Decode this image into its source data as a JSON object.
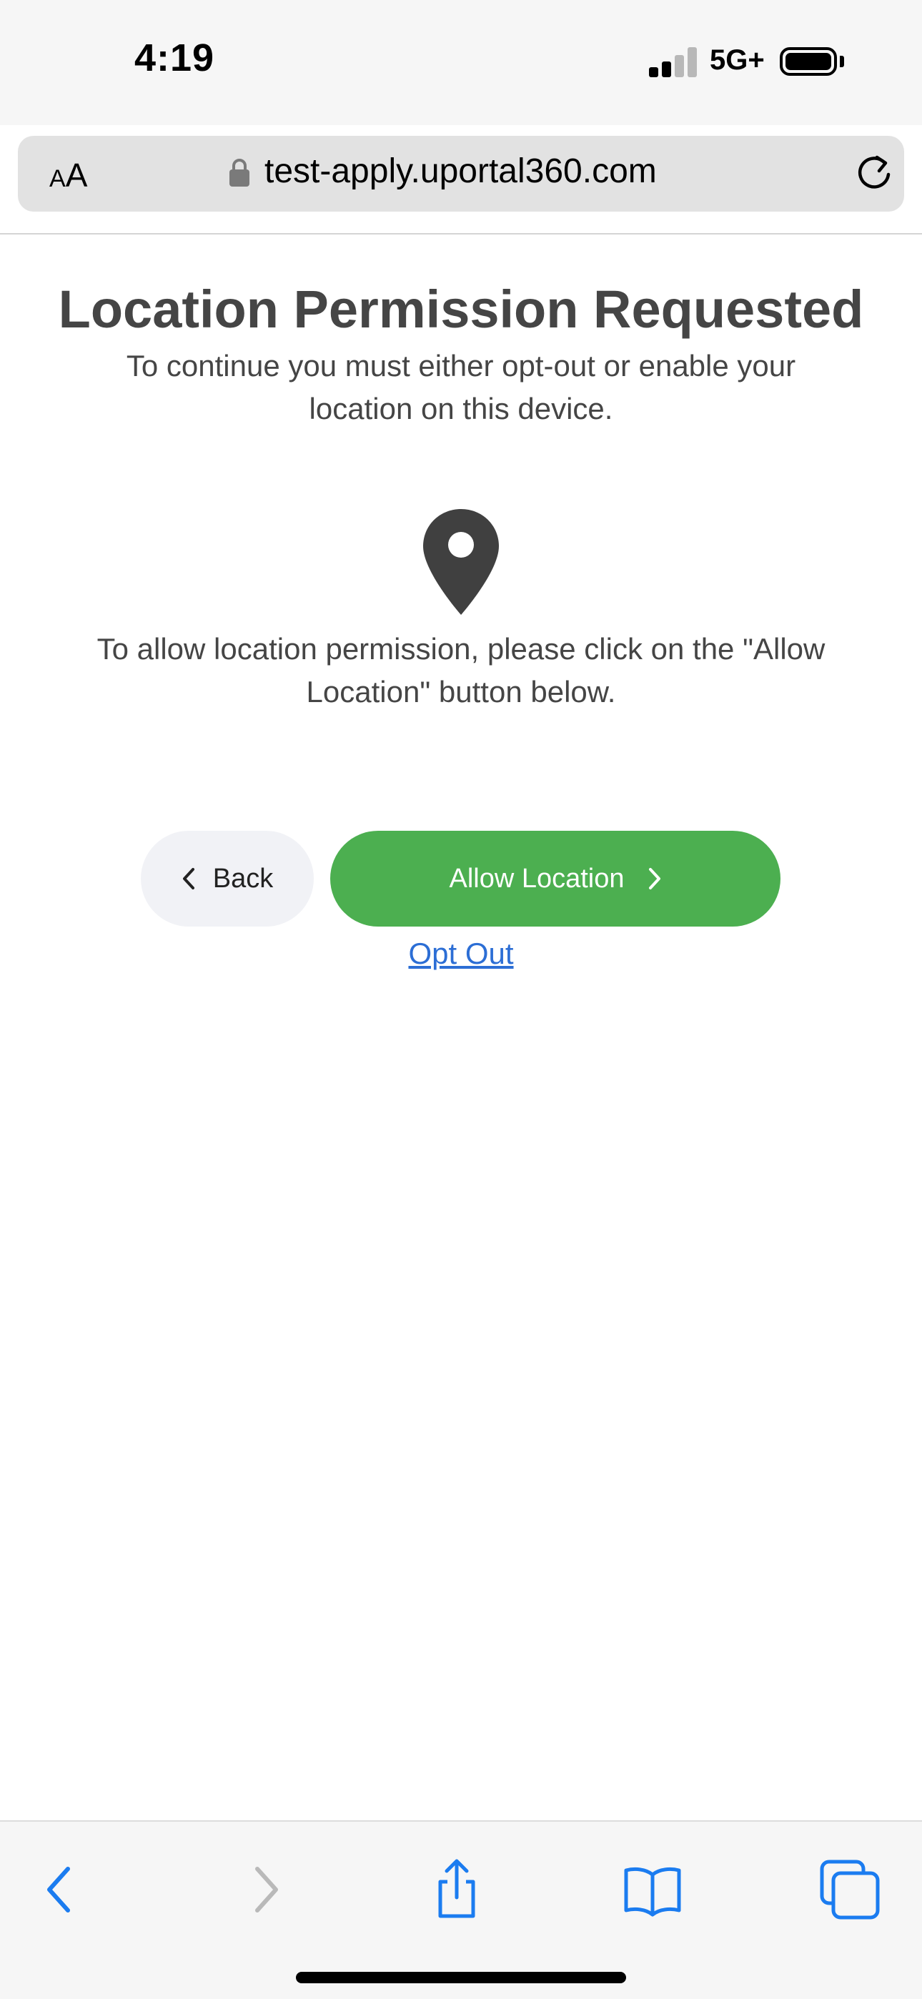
{
  "status_bar": {
    "time": "4:19",
    "network": "5G+",
    "signal_bars_active": 2,
    "signal_bars_total": 4
  },
  "browser": {
    "text_size_small": "A",
    "text_size_large": "A",
    "url": "test-apply.uportal360.com"
  },
  "page": {
    "title": "Location Permission Requested",
    "subtitle": "To continue you must either opt-out or enable your location on this device.",
    "instruction": "To allow location permission, please click on the \"Allow Location\" button below.",
    "back_label": "Back",
    "allow_label": "Allow Location",
    "opt_out_label": "Opt Out"
  },
  "colors": {
    "primary_green": "#4caf50",
    "link_blue": "#2c6ed5",
    "text_gray": "#454545",
    "safari_blue": "#1b7cf0",
    "disabled_gray": "#b9b9b9"
  },
  "icons": {
    "pin": "map-pin-icon",
    "back": "chevron-left-icon",
    "allow": "chevron-right-icon",
    "lock": "lock-icon",
    "reload": "reload-icon"
  },
  "toolbar": {
    "back_enabled": true,
    "forward_enabled": false
  }
}
